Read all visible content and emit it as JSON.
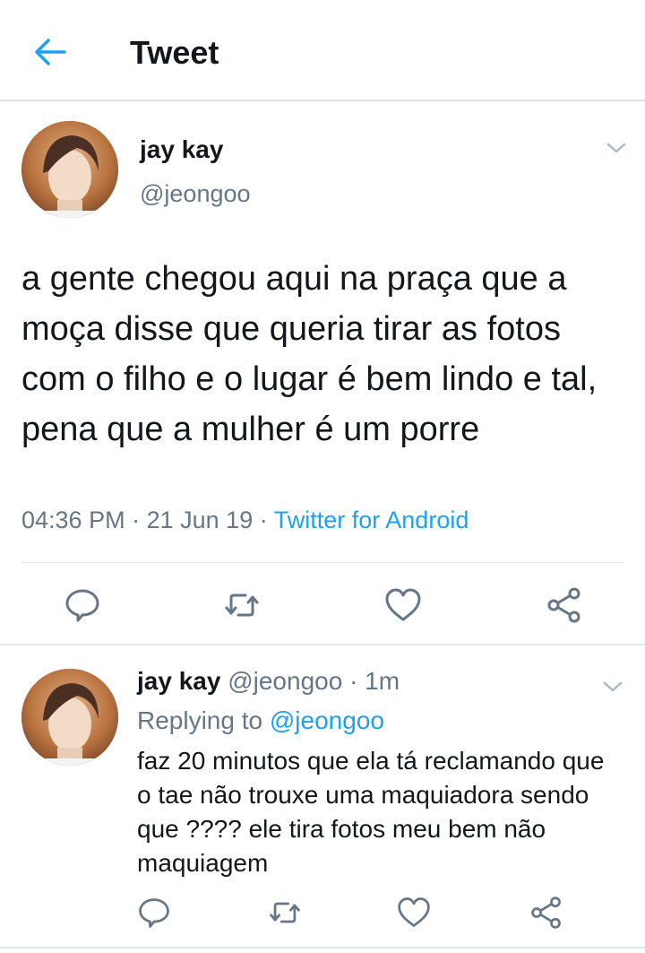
{
  "header": {
    "title": "Tweet",
    "back_icon": "arrow-left-icon",
    "accent_color": "#1da1f2"
  },
  "main_tweet": {
    "display_name": "jay kay",
    "handle": "@jeongoo",
    "text": "a gente chegou aqui na praça que a moça disse que queria tirar as fotos com o filho e o lugar é bem lindo e tal, pena que a mulher é um porre",
    "time": "04:36 PM",
    "date": "21 Jun 19",
    "separator": "·",
    "source": "Twitter for Android",
    "actions": [
      "reply-icon",
      "retweet-icon",
      "like-icon",
      "share-icon"
    ]
  },
  "reply_tweet": {
    "display_name": "jay kay",
    "handle": "@jeongoo",
    "separator": "·",
    "age": "1m",
    "replying_prefix": "Replying to",
    "replying_to": "@jeongoo",
    "text": "faz 20 minutos que ela tá reclamando que o tae não trouxe uma maquiadora sendo que ???? ele tira fotos meu bem não maquiagem",
    "actions": [
      "reply-icon",
      "retweet-icon",
      "like-icon",
      "share-icon"
    ]
  }
}
